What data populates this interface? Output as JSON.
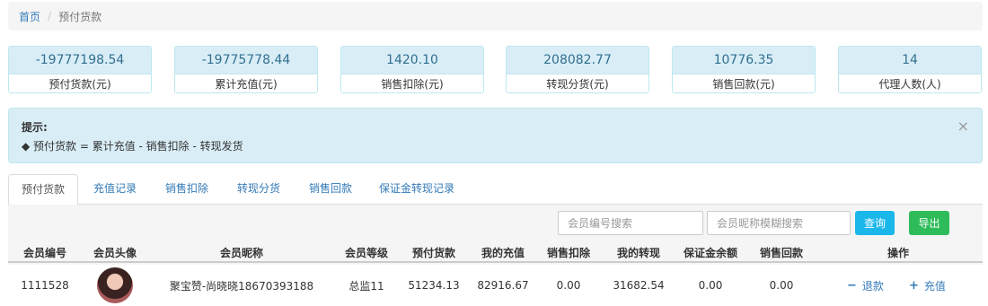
{
  "breadcrumb": {
    "home": "首页",
    "separator": "/",
    "current": "预付货款"
  },
  "stats": [
    {
      "value": "-19777198.54",
      "label": "预付货款(元)"
    },
    {
      "value": "-19775778.44",
      "label": "累计充值(元)"
    },
    {
      "value": "1420.10",
      "label": "销售扣除(元)"
    },
    {
      "value": "208082.77",
      "label": "转现分货(元)"
    },
    {
      "value": "10776.35",
      "label": "销售回款(元)"
    },
    {
      "value": "14",
      "label": "代理人数(人)"
    }
  ],
  "alert": {
    "title": "提示:",
    "text": "◆ 预付货款 = 累计充值 - 销售扣除 - 转现发货",
    "close": "×"
  },
  "tabs": [
    "预付货款",
    "充值记录",
    "销售扣除",
    "转现分货",
    "销售回款",
    "保证金转现记录"
  ],
  "active_tab": "预付货款",
  "search": {
    "member_no_placeholder": "会员编号搜索",
    "nickname_placeholder": "会员昵称模糊搜索",
    "query_label": "查询",
    "export_label": "导出"
  },
  "table": {
    "columns": [
      "会员编号",
      "会员头像",
      "会员昵称",
      "会员等级",
      "预付货款",
      "我的充值",
      "销售扣除",
      "我的转现",
      "保证金余额",
      "销售回款",
      "操作"
    ],
    "rows": [
      {
        "member_no": "1111528",
        "nickname": "聚宝赞-尚晓晓18670393188",
        "level": "总监11",
        "prepay": "51234.13",
        "recharge": "82916.67",
        "sales_deduct": "0.00",
        "withdraw": "31682.54",
        "deposit_balance": "0.00",
        "sales_return": "0.00",
        "actions": {
          "refund": "退款",
          "recharge": "充值"
        }
      }
    ]
  },
  "colors": {
    "accent": "#337ab7",
    "info_bg": "#d9edf7",
    "query": "#1ab7ea",
    "export": "#2ebc5a"
  },
  "icons": {
    "minus": "−",
    "plus": "+"
  }
}
